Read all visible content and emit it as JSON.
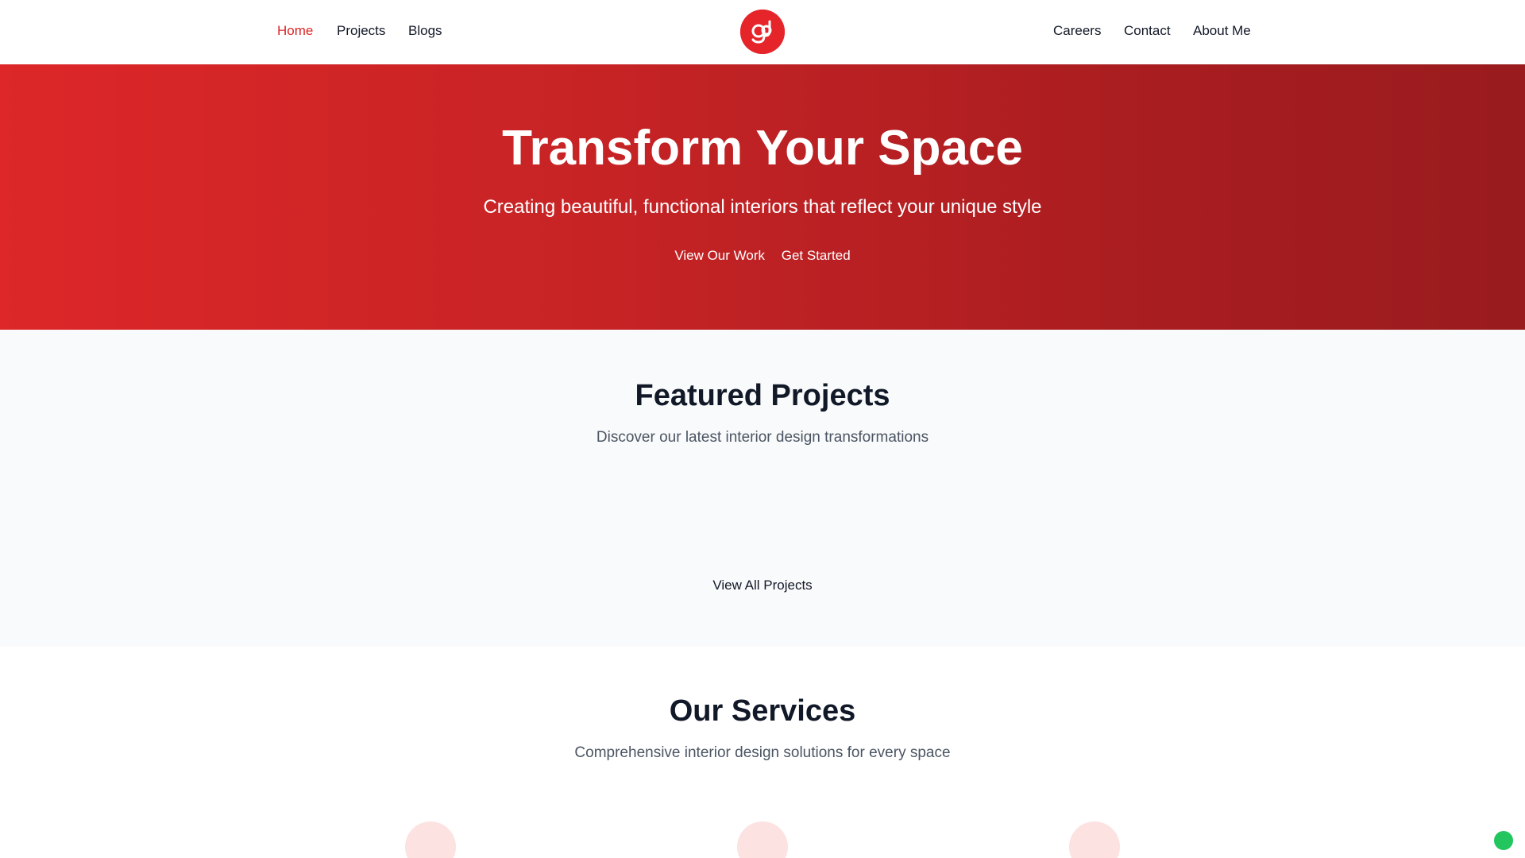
{
  "nav": {
    "left": [
      {
        "label": "Home",
        "active": true
      },
      {
        "label": "Projects",
        "active": false
      },
      {
        "label": "Blogs",
        "active": false
      }
    ],
    "right": [
      {
        "label": "Careers"
      },
      {
        "label": "Contact"
      },
      {
        "label": "About Me"
      }
    ],
    "logo_icon": "brand-logo-icon"
  },
  "hero": {
    "title": "Transform Your Space",
    "subtitle": "Creating beautiful, functional interiors that reflect your unique style",
    "primary_button": "View Our Work",
    "secondary_button": "Get Started"
  },
  "featured": {
    "title": "Featured Projects",
    "subtitle": "Discover our latest interior design transformations",
    "view_all": "View All Projects"
  },
  "services": {
    "title": "Our Services",
    "subtitle": "Comprehensive interior design solutions for every space",
    "icons": [
      "service-icon",
      "service-icon",
      "service-icon"
    ]
  },
  "colors": {
    "accent": "#dc2626",
    "hero_start": "#dd2728",
    "hero_end": "#991b1e",
    "service_icon_bg": "#fde2e2",
    "status": "#22c55e"
  }
}
